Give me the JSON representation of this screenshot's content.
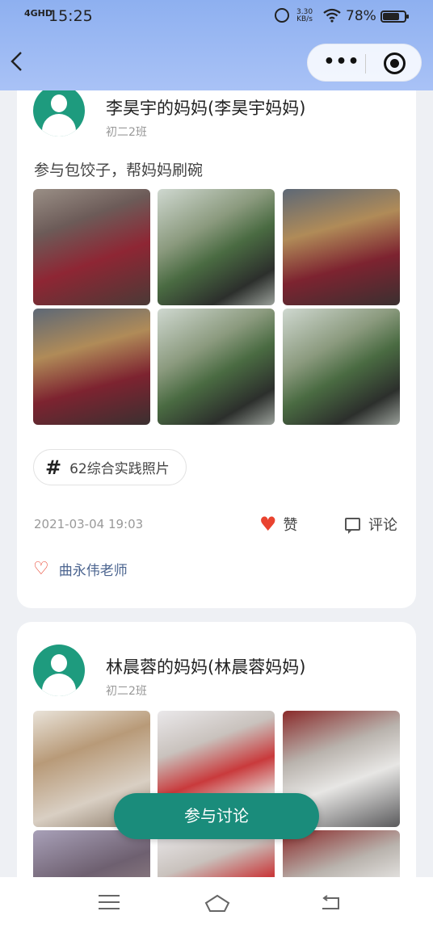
{
  "status_bar": {
    "signal": "4GHD",
    "time": "15:25",
    "net_speed_value": "3.30",
    "net_speed_unit": "KB/s",
    "battery_percent": "78%",
    "battery_level": 0.78
  },
  "nav": {
    "back_icon": "back-arrow-icon",
    "more_icon": "more-dots-icon",
    "close_icon": "target-circle-icon"
  },
  "posts": [
    {
      "author": "李昊宇的妈妈(李昊宇妈妈)",
      "class_name": "初二2班",
      "content": "参与包饺子，帮妈妈刷碗",
      "photo_count": 6,
      "tag": "62综合实践照片",
      "datetime": "2021-03-04 19:03",
      "like_label": "赞",
      "comment_label": "评论",
      "liked_by": "曲永伟老师"
    },
    {
      "author": "林晨蓉的妈妈(林晨蓉妈妈)",
      "class_name": "初二2班"
    }
  ],
  "fab": {
    "label": "参与讨论"
  },
  "system_nav": {
    "menu_icon": "menu-icon",
    "home_icon": "home-icon",
    "back_icon": "back-icon"
  },
  "colors": {
    "header_gradient_top": "#8eb0f0",
    "accent_green": "#1a8c7b",
    "avatar_green": "#1e9b7e",
    "like_red": "#e9432f",
    "liker_blue": "#4c6590"
  }
}
